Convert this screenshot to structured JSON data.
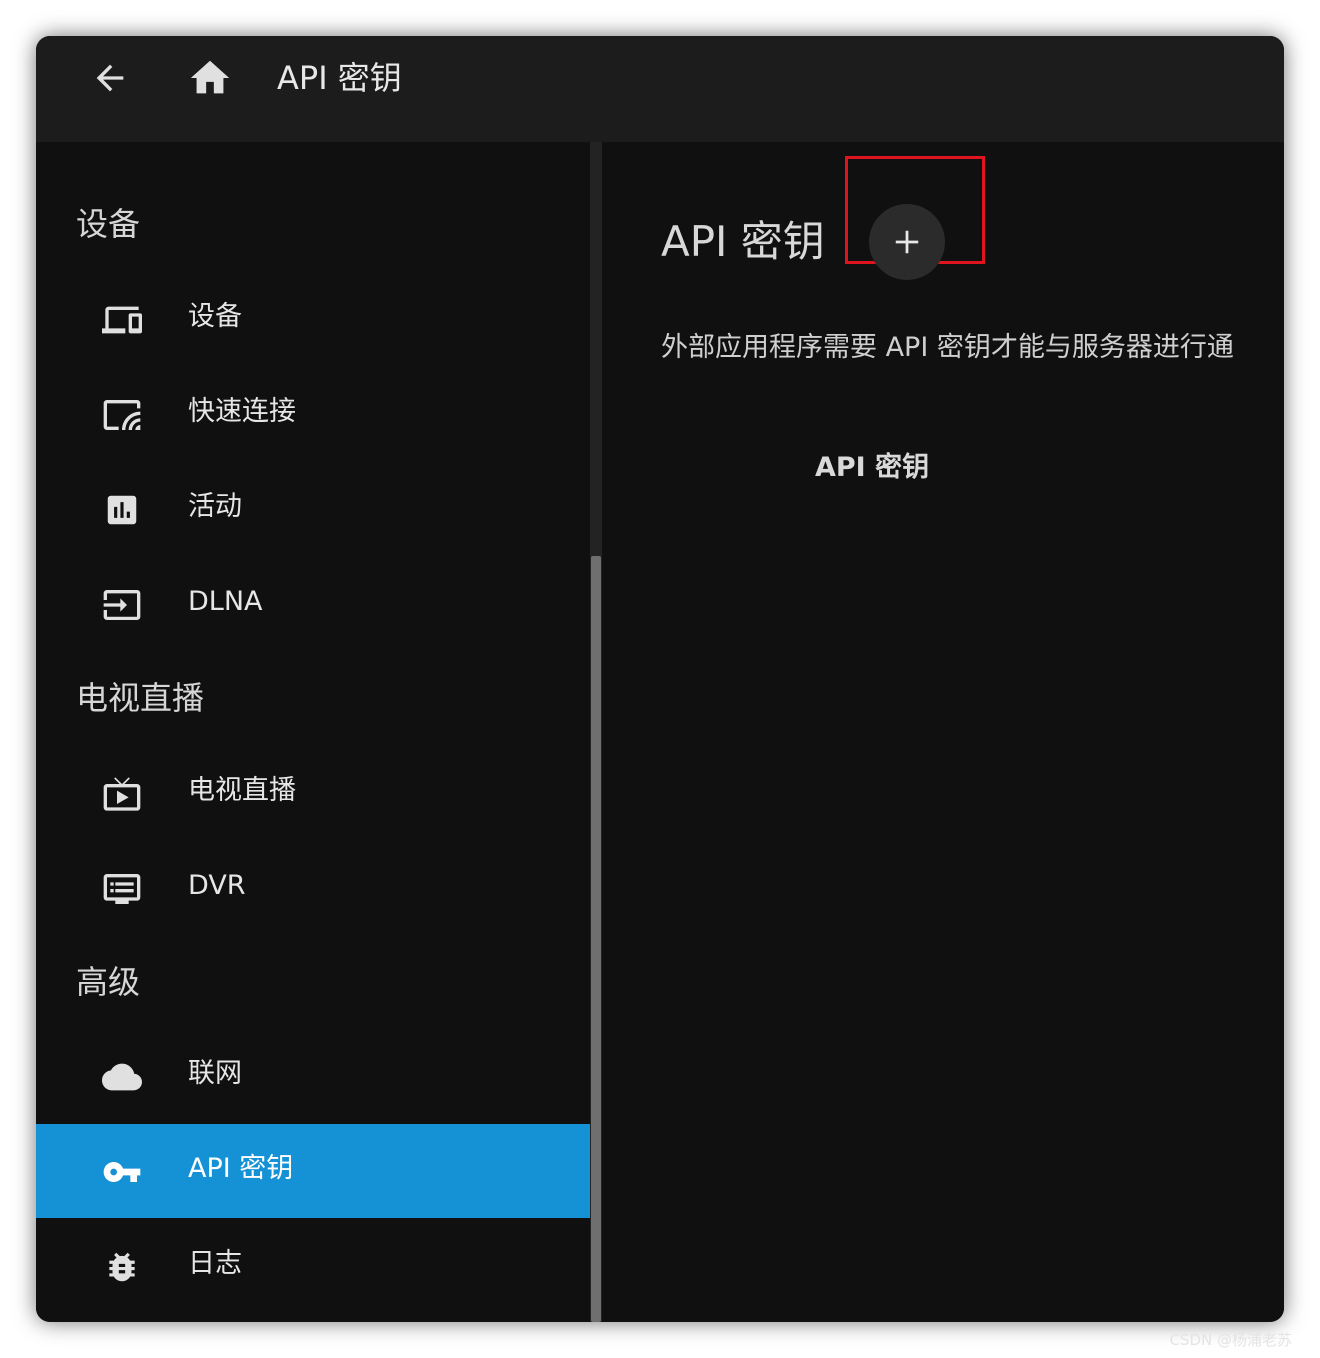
{
  "app_bar": {
    "title": "API 密钥",
    "back_icon": "arrow-left-icon",
    "home_icon": "home-icon"
  },
  "sidebar": {
    "sections": [
      {
        "header": "设备",
        "items": [
          {
            "label": "设备",
            "icon": "devices-icon"
          },
          {
            "label": "快速连接",
            "icon": "cast-icon"
          },
          {
            "label": "活动",
            "icon": "bar-chart-icon"
          },
          {
            "label": "DLNA",
            "icon": "input-icon"
          }
        ]
      },
      {
        "header": "电视直播",
        "items": [
          {
            "label": "电视直播",
            "icon": "live-tv-icon"
          },
          {
            "label": "DVR",
            "icon": "dvr-icon"
          }
        ]
      },
      {
        "header": "高级",
        "items": [
          {
            "label": "联网",
            "icon": "cloud-icon"
          },
          {
            "label": "API 密钥",
            "icon": "key-icon",
            "active": true
          },
          {
            "label": "日志",
            "icon": "bug-icon"
          }
        ]
      }
    ]
  },
  "main": {
    "title": "API 密钥",
    "add_button_glyph": "+",
    "description": "外部应用程序需要 API 密钥才能与服务器进行通",
    "table_header": "API 密钥"
  },
  "watermark": "CSDN @杨浦老苏",
  "colors": {
    "active_item": "#1592d6",
    "highlight_box": "#e0141e",
    "app_bar": "#1c1c1c",
    "background": "#101010"
  }
}
